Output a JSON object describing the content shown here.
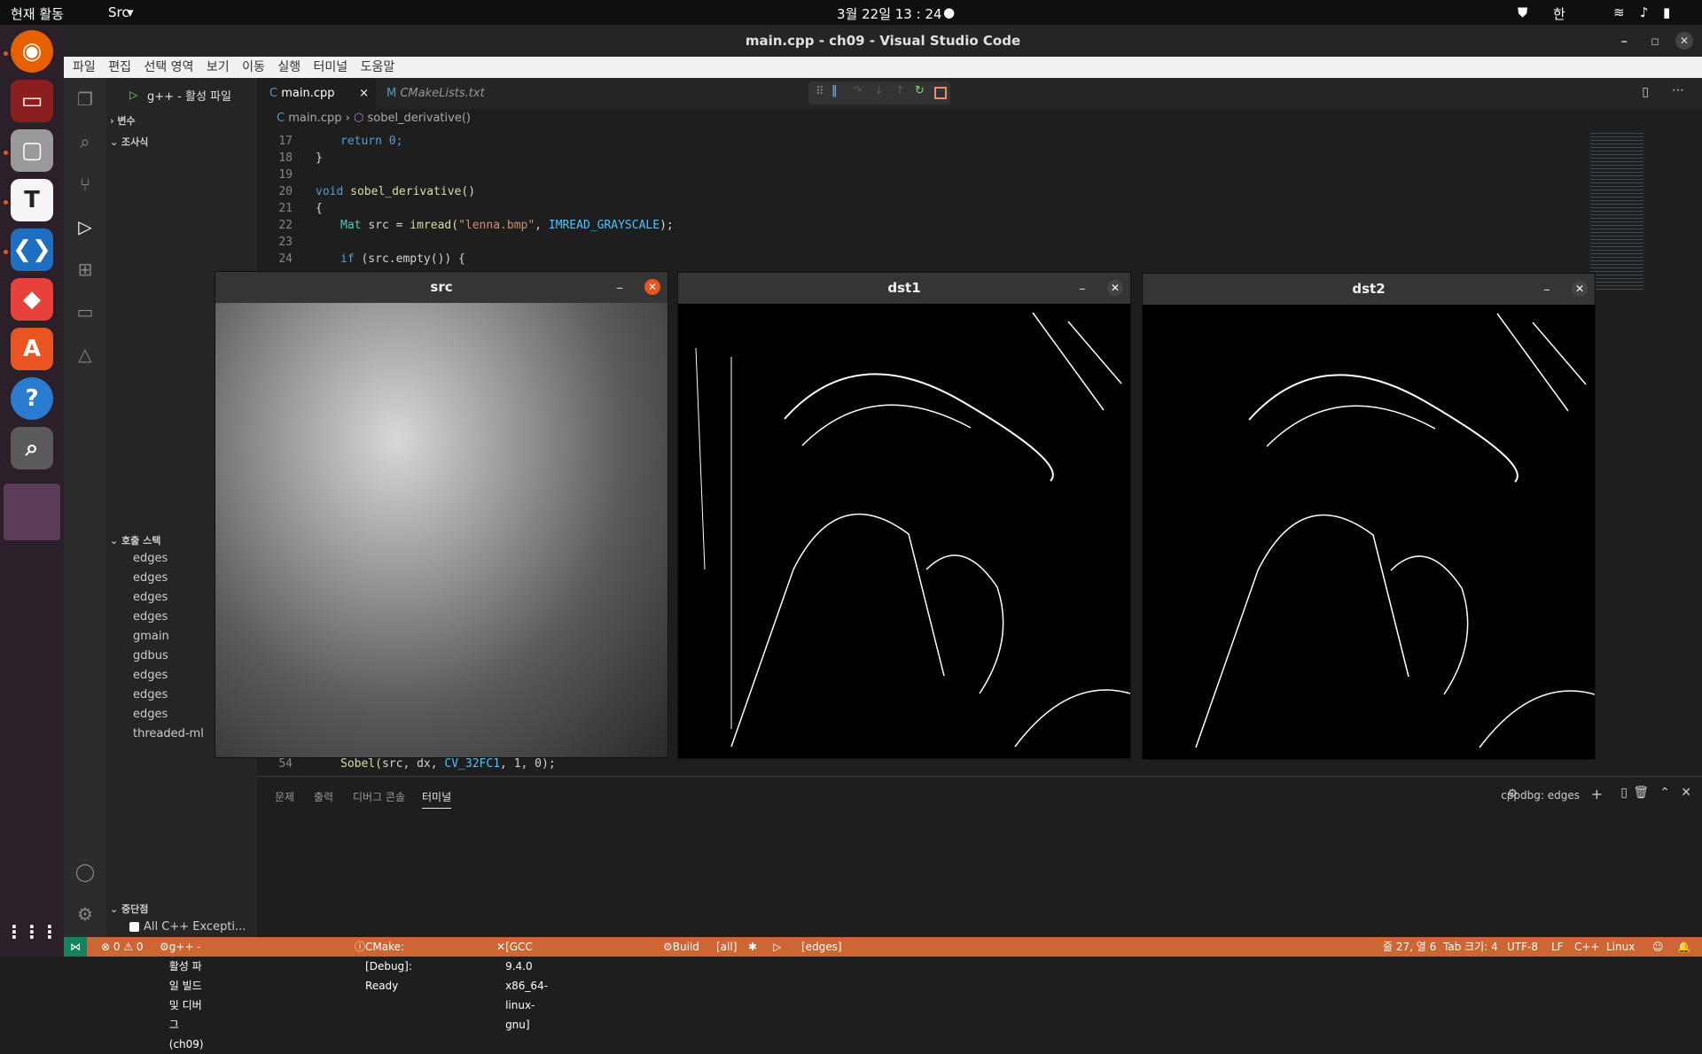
{
  "topbar": {
    "activities": "현재 활동",
    "app": "Src",
    "datetime": "3월 22일  13 : 24",
    "lang": "한"
  },
  "window": {
    "title": "main.cpp - ch09 - Visual Studio Code"
  },
  "menu": [
    "파일",
    "편집",
    "선택 영역",
    "보기",
    "이동",
    "실행",
    "터미널",
    "도움말"
  ],
  "debug_config": "g++ - 활성 파일",
  "tabs": [
    {
      "label": "main.cpp"
    },
    {
      "label": "CMakeLists.txt"
    }
  ],
  "breadcrumb": {
    "file": "main.cpp",
    "symbol": "sobel_derivative()"
  },
  "sidebar": {
    "variables": "변수",
    "watch": "조사식",
    "callstack": "호출 스택",
    "stack_items": [
      "edges",
      "edges",
      "edges",
      "edges",
      "gmain",
      "gdbus",
      "edges",
      "edges",
      "edges",
      "threaded-ml"
    ],
    "breakpoints": "중단점",
    "bp_item": "All C++ Excepti..."
  },
  "code": {
    "lines": [
      "17",
      "18",
      "19",
      "20",
      "21",
      "22",
      "23",
      "24",
      "54"
    ],
    "l17": "return 0;",
    "l18": "}",
    "l20_kw": "void",
    "l20_fn": "sobel_derivative()",
    "l21": "{",
    "l22_ty": "Mat",
    "l22_a": "src = ",
    "l22_fn": "imread(",
    "l22_st": "\"lenna.bmp\"",
    "l22_cn": "IMREAD_GRAYSCALE",
    "l22_end": ");",
    "l24_kw": "if",
    "l24_rest": "(src.empty()) {",
    "l54_fn": "Sobel(",
    "l54_a": "src, dx, ",
    "l54_cn": "CV_32FC1",
    "l54_b": ", 1, 0);"
  },
  "panel": {
    "tabs": [
      "문제",
      "출력",
      "디버그 콘솔",
      "터미널"
    ],
    "active": "터미널",
    "session": "cppdbg: edges"
  },
  "windows": [
    {
      "title": "src"
    },
    {
      "title": "dst1"
    },
    {
      "title": "dst2"
    }
  ],
  "status": {
    "errors": "⊗ 0 ⚠ 0",
    "build": "g++ - 활성 파일 빌드 및 디버그 (ch09)",
    "cmake": "CMake: [Debug]: Ready",
    "kit": "[GCC 9.4.0 x86_64-linux-gnu]",
    "build_btn": "Build",
    "target": "[all]",
    "launch": "[edges]",
    "cursor": "줄 27, 열 6",
    "tab": "Tab 크기: 4",
    "encoding": "UTF-8",
    "eol": "LF",
    "lang": "C++",
    "os": "Linux"
  }
}
